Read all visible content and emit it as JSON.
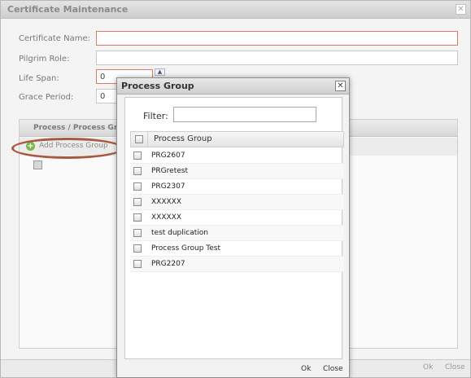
{
  "main": {
    "title": "Certificate Maintenance",
    "close_glyph": "✕",
    "fields": {
      "certificate_name_label": "Certificate Name:",
      "certificate_name_value": "",
      "pilgrim_role_label": "Pilgrim Role:",
      "pilgrim_role_value": "",
      "life_span_label": "Life Span:",
      "life_span_value": "0",
      "grace_period_label": "Grace Period:",
      "grace_period_value": "0"
    },
    "grid": {
      "header": "Process / Process Grou",
      "add_button_label": "Add Process Group"
    },
    "footer": {
      "ok_label": "Ok",
      "close_label": "Close"
    }
  },
  "popup": {
    "title": "Process Group",
    "close_glyph": "✕",
    "filter_label": "Filter:",
    "filter_value": "",
    "column_header": "Process Group",
    "items": [
      "PRG2607",
      "PRGretest",
      "PRG2307",
      "XXXXXX",
      "XXXXXX",
      "test duplication",
      "Process Group Test",
      "PRG2207"
    ],
    "footer": {
      "ok_label": "Ok",
      "close_label": "Close"
    }
  },
  "colors": {
    "required_border": "#e07a5f",
    "highlight": "#a85a3f",
    "add_icon": "#79b84a"
  },
  "icons": {
    "add": "plus-circle-icon",
    "close": "close-icon"
  }
}
